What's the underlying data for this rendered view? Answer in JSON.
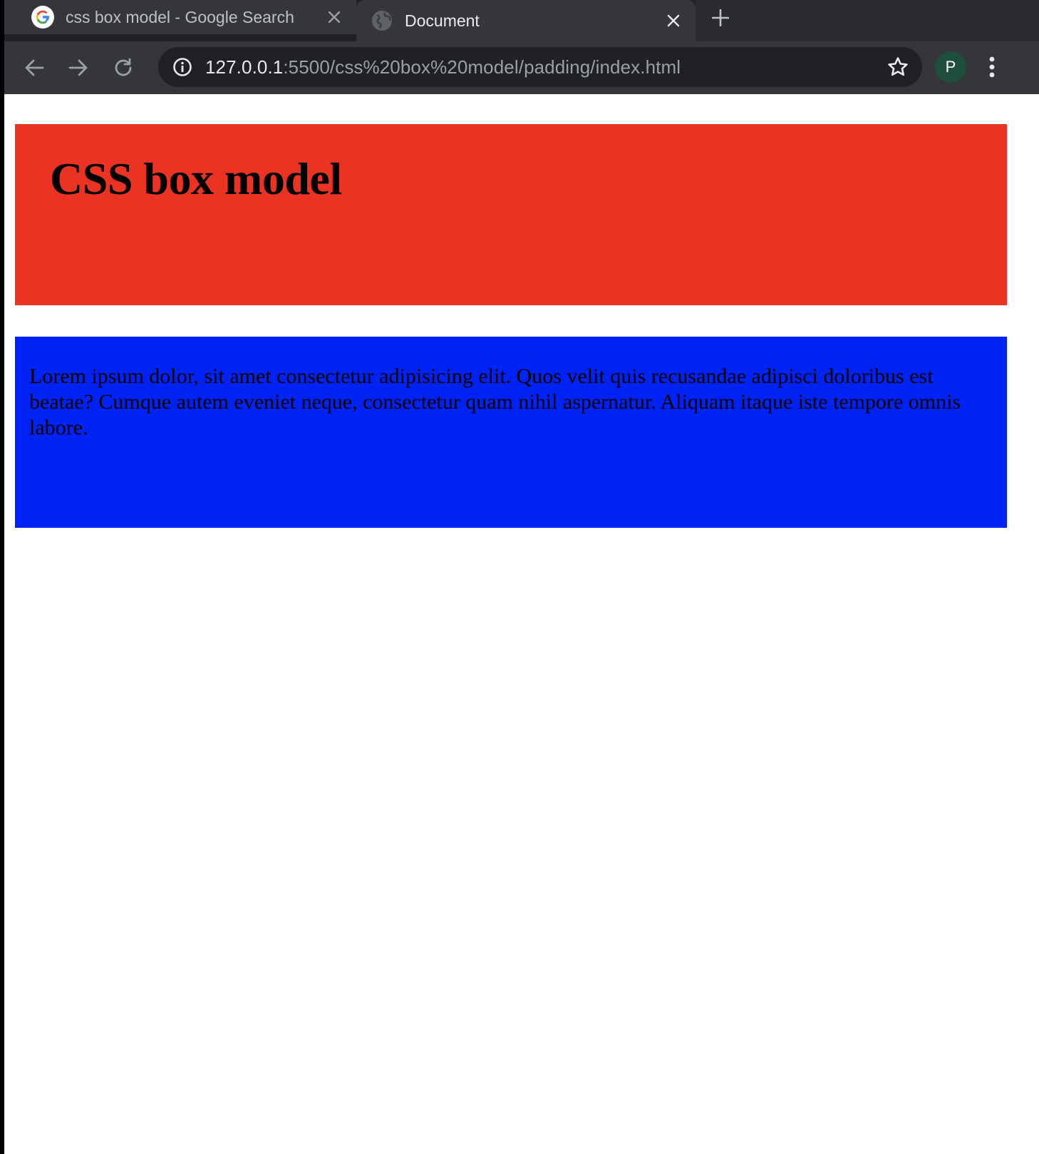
{
  "browser": {
    "tabs": [
      {
        "title": "css box model - Google Search",
        "favicon": "google-g-icon",
        "active": false
      },
      {
        "title": "Document",
        "favicon": "globe-icon",
        "active": true
      }
    ],
    "url_host": "127.0.0.1",
    "url_path": ":5500/css%20box%20model/padding/index.html",
    "profile_initial": "P",
    "colors": {
      "tabstrip": "#202124",
      "toolbar": "#35363a",
      "omnibox": "#202124",
      "avatar": "#1e4f3d"
    }
  },
  "page": {
    "header_title": "CSS box model",
    "content_text": "Lorem ipsum dolor, sit amet consectetur adipisicing elit. Quos velit quis recusandae adipisci doloribus est beatae? Cumque autem eveniet neque, consectetur quam nihil aspernatur. Aliquam itaque iste tempore omnis labore.",
    "colors": {
      "header_background": "#eb3323",
      "content_background": "#0023f5"
    }
  }
}
